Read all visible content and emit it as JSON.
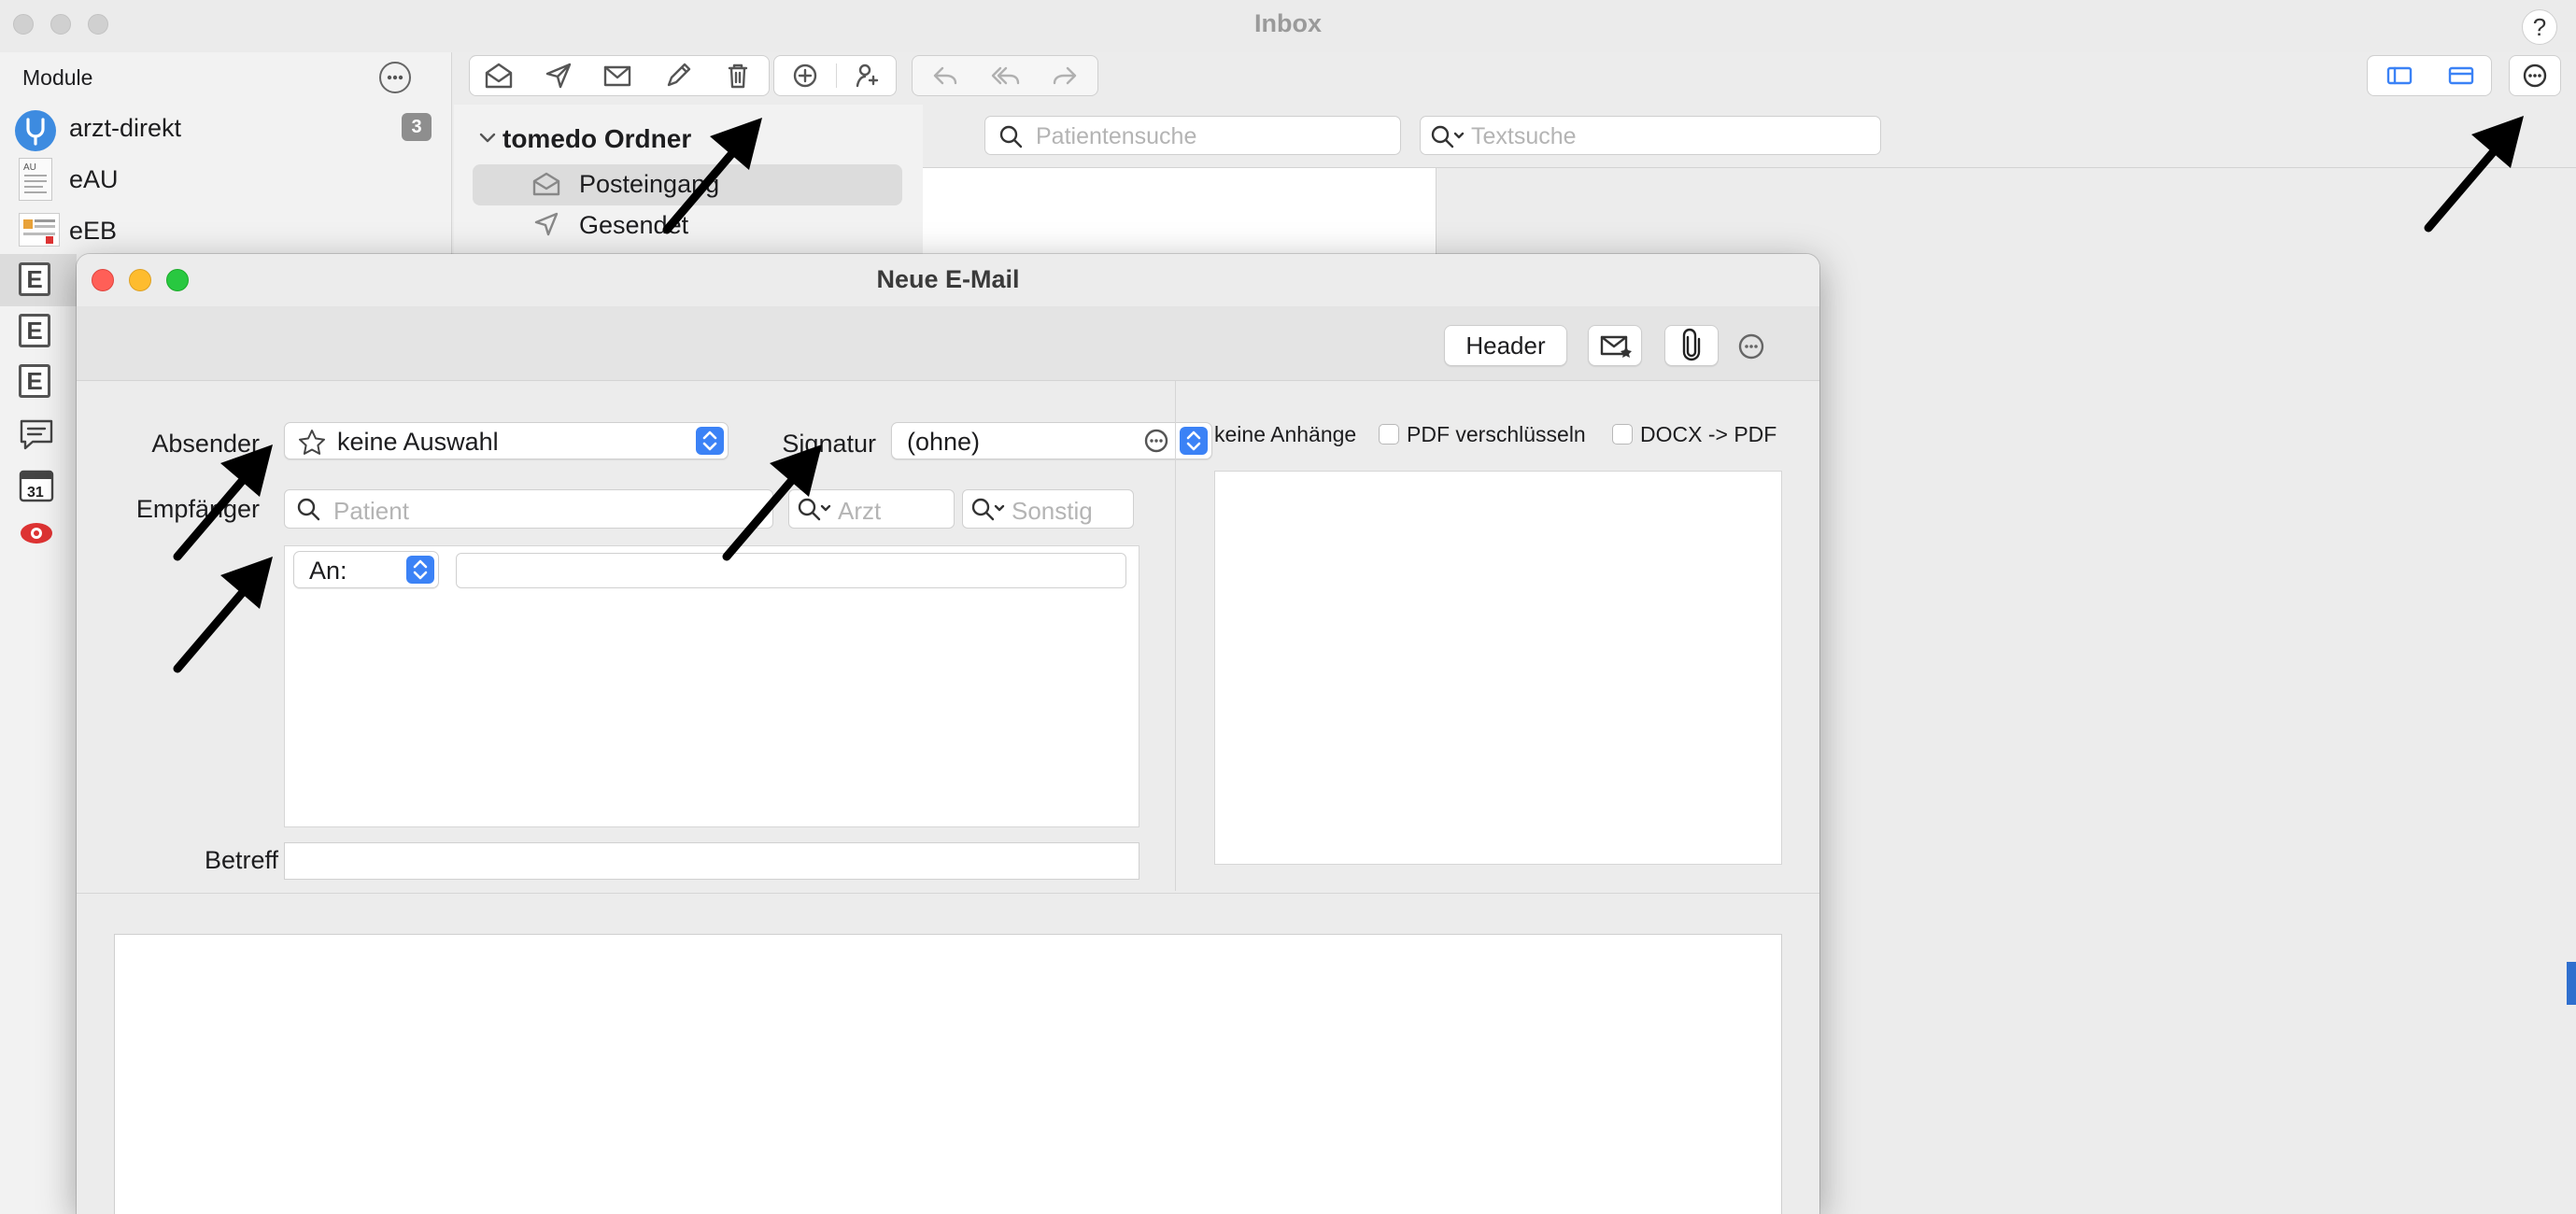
{
  "main_window": {
    "title": "Inbox",
    "help_label": "?"
  },
  "sidebar": {
    "header": "Module",
    "items": [
      {
        "label": "arzt-direkt",
        "badge": "3",
        "icon": "stethoscope-icon"
      },
      {
        "label": "eAU",
        "icon": "eau-document-icon"
      },
      {
        "label": "eEB",
        "icon": "eeb-document-icon"
      },
      {
        "label": "E",
        "icon": "e-box-icon"
      },
      {
        "label": "E",
        "icon": "e-box-icon"
      },
      {
        "label": "E",
        "icon": "e-box-icon"
      },
      {
        "label": "",
        "icon": "chat-bubble-icon"
      },
      {
        "label": "31",
        "icon": "calendar-icon"
      },
      {
        "label": "",
        "icon": "eye-icon"
      }
    ]
  },
  "toolbar": {
    "buttons": [
      "inbox-icon",
      "send-icon",
      "envelope-icon",
      "pen-icon",
      "trash-icon",
      "add-icon",
      "add-contact-icon",
      "reply-icon",
      "reply-all-icon",
      "forward-icon"
    ],
    "right_buttons": [
      "sidebar-layout-icon",
      "panel-layout-icon",
      "more-icon"
    ]
  },
  "folders": {
    "root": "tomedo Ordner",
    "items": [
      {
        "label": "Posteingang",
        "selected": true
      },
      {
        "label": "Gesendet",
        "selected": false
      }
    ]
  },
  "search": {
    "patient_placeholder": "Patientensuche",
    "text_placeholder": "Textsuche"
  },
  "compose": {
    "title": "Neue E-Mail",
    "header_button": "Header",
    "sender_label": "Absender",
    "sender_value": "keine Auswahl",
    "signature_label": "Signatur",
    "signature_value": "(ohne)",
    "recipient_label": "Empfänger",
    "patient_placeholder": "Patient",
    "doctor_placeholder": "Arzt",
    "other_placeholder": "Sonstig",
    "to_select": "An:",
    "to_value": "",
    "subject_label": "Betreff",
    "subject_value": "",
    "attachments_label": "keine Anhänge",
    "pdf_encrypt_label": "PDF verschlüsseln",
    "pdf_encrypt_checked": false,
    "docx_pdf_label": "DOCX -> PDF",
    "docx_pdf_checked": false,
    "body": ""
  },
  "colors": {
    "accent": "#3b82f6",
    "close": "#ff5f57",
    "minimize": "#febc2e",
    "zoom": "#28c840",
    "badge": "#8e8e8e"
  }
}
